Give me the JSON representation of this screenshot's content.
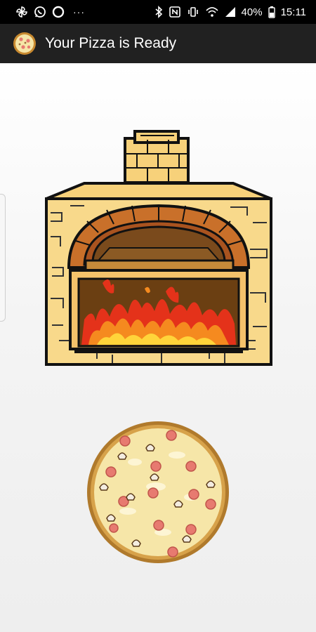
{
  "status_bar": {
    "time": "15:11",
    "battery": "40%",
    "left_icons": [
      "pinwheel-icon",
      "whatsapp-icon",
      "circle-icon",
      "more-dots-icon"
    ],
    "right_icons": [
      "bluetooth-icon",
      "nfc-icon",
      "vibrate-icon",
      "wifi-icon",
      "signal-icon",
      "battery-icon"
    ]
  },
  "app_bar": {
    "title": "Your Pizza is Ready",
    "icon": "pizza-app-icon",
    "background": "#212121"
  },
  "scene": {
    "oven": "brick-oven-with-fire",
    "pizza": "pepperoni-mushroom-pizza"
  }
}
